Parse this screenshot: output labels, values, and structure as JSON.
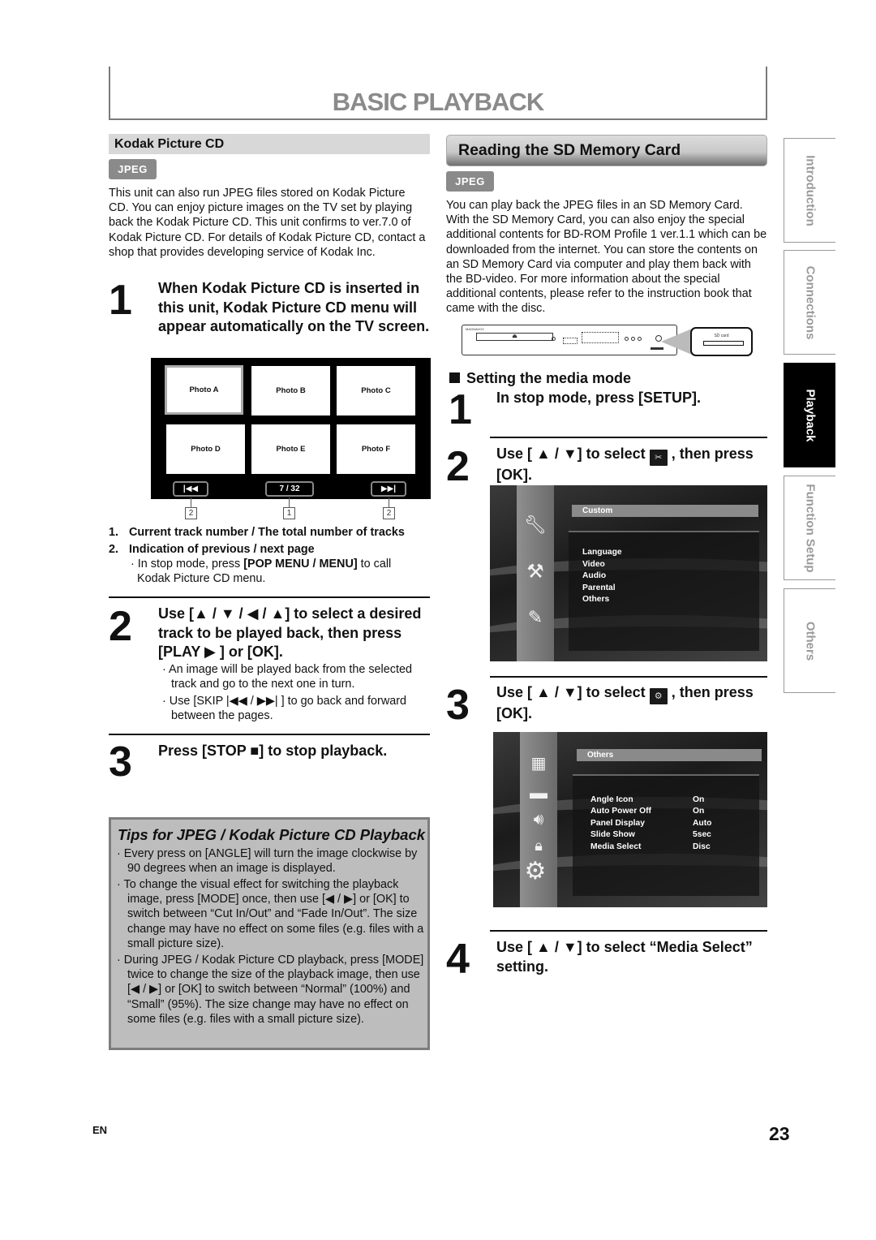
{
  "page_title": "BASIC PLAYBACK",
  "left": {
    "subheading": "Kodak Picture CD",
    "badge": "JPEG",
    "intro": "This unit can also run JPEG files stored on Kodak Picture CD. You can enjoy picture images on the TV set by playing back the Kodak Picture CD. This unit confirms to ver.7.0 of Kodak Picture CD. For details of Kodak Picture CD, contact a shop that provides developing service of Kodak Inc.",
    "step1": {
      "num": "1",
      "text": "When Kodak Picture CD is inserted in this unit, Kodak Picture CD menu will appear automatically on the TV screen."
    },
    "kodak_menu": {
      "photos": [
        "Photo A",
        "Photo B",
        "Photo C",
        "Photo D",
        "Photo E",
        "Photo F"
      ],
      "prev_icon": "skip-back-icon",
      "prev_glyph": "|◀◀",
      "counter": "7 /  32",
      "next_icon": "skip-forward-icon",
      "next_glyph": "▶▶|",
      "callouts": [
        "2",
        "1",
        "2"
      ]
    },
    "legend": [
      {
        "num": "1.",
        "text": "Current track number / The total number of tracks"
      },
      {
        "num": "2.",
        "text": "Indication of previous / next page"
      }
    ],
    "legend_note": {
      "prefix": "In stop mode, press ",
      "key": "[POP MENU / MENU]",
      "suffix": " to call Kodak Picture CD menu."
    },
    "step2": {
      "num": "2",
      "text": "Use [▲ / ▼ / ◀ / ▲] to select a desired track to be played back, then press [PLAY ▶ ] or [OK].",
      "bullets": [
        "An image will be played back from the selected track and go to the next one in turn.",
        "Use [SKIP |◀◀ / ▶▶| ] to go back and forward between the pages."
      ]
    },
    "step3": {
      "num": "3",
      "text": "Press [STOP ■] to stop playback."
    },
    "tips": {
      "title": "Tips for JPEG / Kodak Picture CD Playback",
      "items": [
        "Every press on [ANGLE] will turn the image clockwise by 90 degrees when an image is displayed.",
        "To change the visual effect for switching the playback image, press [MODE] once, then use [◀ / ▶] or [OK] to switch between “Cut In/Out” and “Fade In/Out”. The size change may have no effect on some files (e.g. files with a small picture size).",
        "During JPEG / Kodak Picture CD playback, press [MODE] twice to change the size of the playback image, then use [◀ / ▶] or [OK] to switch between “Normal” (100%) and “Small” (95%). The size change may have no effect on some files (e.g. files with a small picture size)."
      ]
    }
  },
  "right": {
    "heading": "Reading the SD Memory Card",
    "badge": "JPEG",
    "intro": "You can play back the JPEG files in an SD Memory Card. With the SD Memory Card, you can also enjoy the special additional contents for BD-ROM Profile 1 ver.1.1 which can be downloaded from the internet. You can store the contents on an SD Memory Card via computer and play them back with the BD-video. For more information about the special additional contents, please refer to the instruction book that came with the disc.",
    "player": {
      "brand": "MAGNAVOX",
      "sd_label": "SD card"
    },
    "media_heading": "Setting the media mode",
    "step1": {
      "num": "1",
      "text": "In stop mode, press [SETUP]."
    },
    "step2": {
      "num": "2",
      "text_before": "Use [ ▲ / ▼] to select",
      "text_after": ", then press [OK].",
      "icon": "tools-icon"
    },
    "menu1": {
      "highlight": "Custom",
      "items": [
        "Language",
        "Video",
        "Audio",
        "Parental",
        "Others"
      ],
      "side_icons": [
        "wrench-icon",
        "tools-icon",
        "edit-icon"
      ]
    },
    "step3": {
      "num": "3",
      "text_before": "Use [ ▲ / ▼] to select",
      "text_after": ", then press [OK].",
      "icon": "gears-icon"
    },
    "menu2": {
      "highlight": "Others",
      "items": [
        {
          "label": "Angle Icon",
          "value": "On"
        },
        {
          "label": "Auto Power Off",
          "value": "On"
        },
        {
          "label": "Panel Display",
          "value": "Auto"
        },
        {
          "label": "Slide Show",
          "value": "5sec"
        },
        {
          "label": "Media Select",
          "value": "Disc"
        }
      ],
      "side_icons": [
        "language-icon",
        "monitor-icon",
        "speaker-icon",
        "lock-icon",
        "gears-icon"
      ]
    },
    "step4": {
      "num": "4",
      "text": "Use [ ▲ / ▼] to select “Media Select” setting."
    }
  },
  "side_tabs": [
    {
      "label": "Introduction",
      "active": false
    },
    {
      "label": "Connections",
      "active": false
    },
    {
      "label": "Playback",
      "active": true
    },
    {
      "label": "Function Setup",
      "active": false
    },
    {
      "label": "Others",
      "active": false
    }
  ],
  "footer": {
    "lang": "EN",
    "page": "23"
  }
}
